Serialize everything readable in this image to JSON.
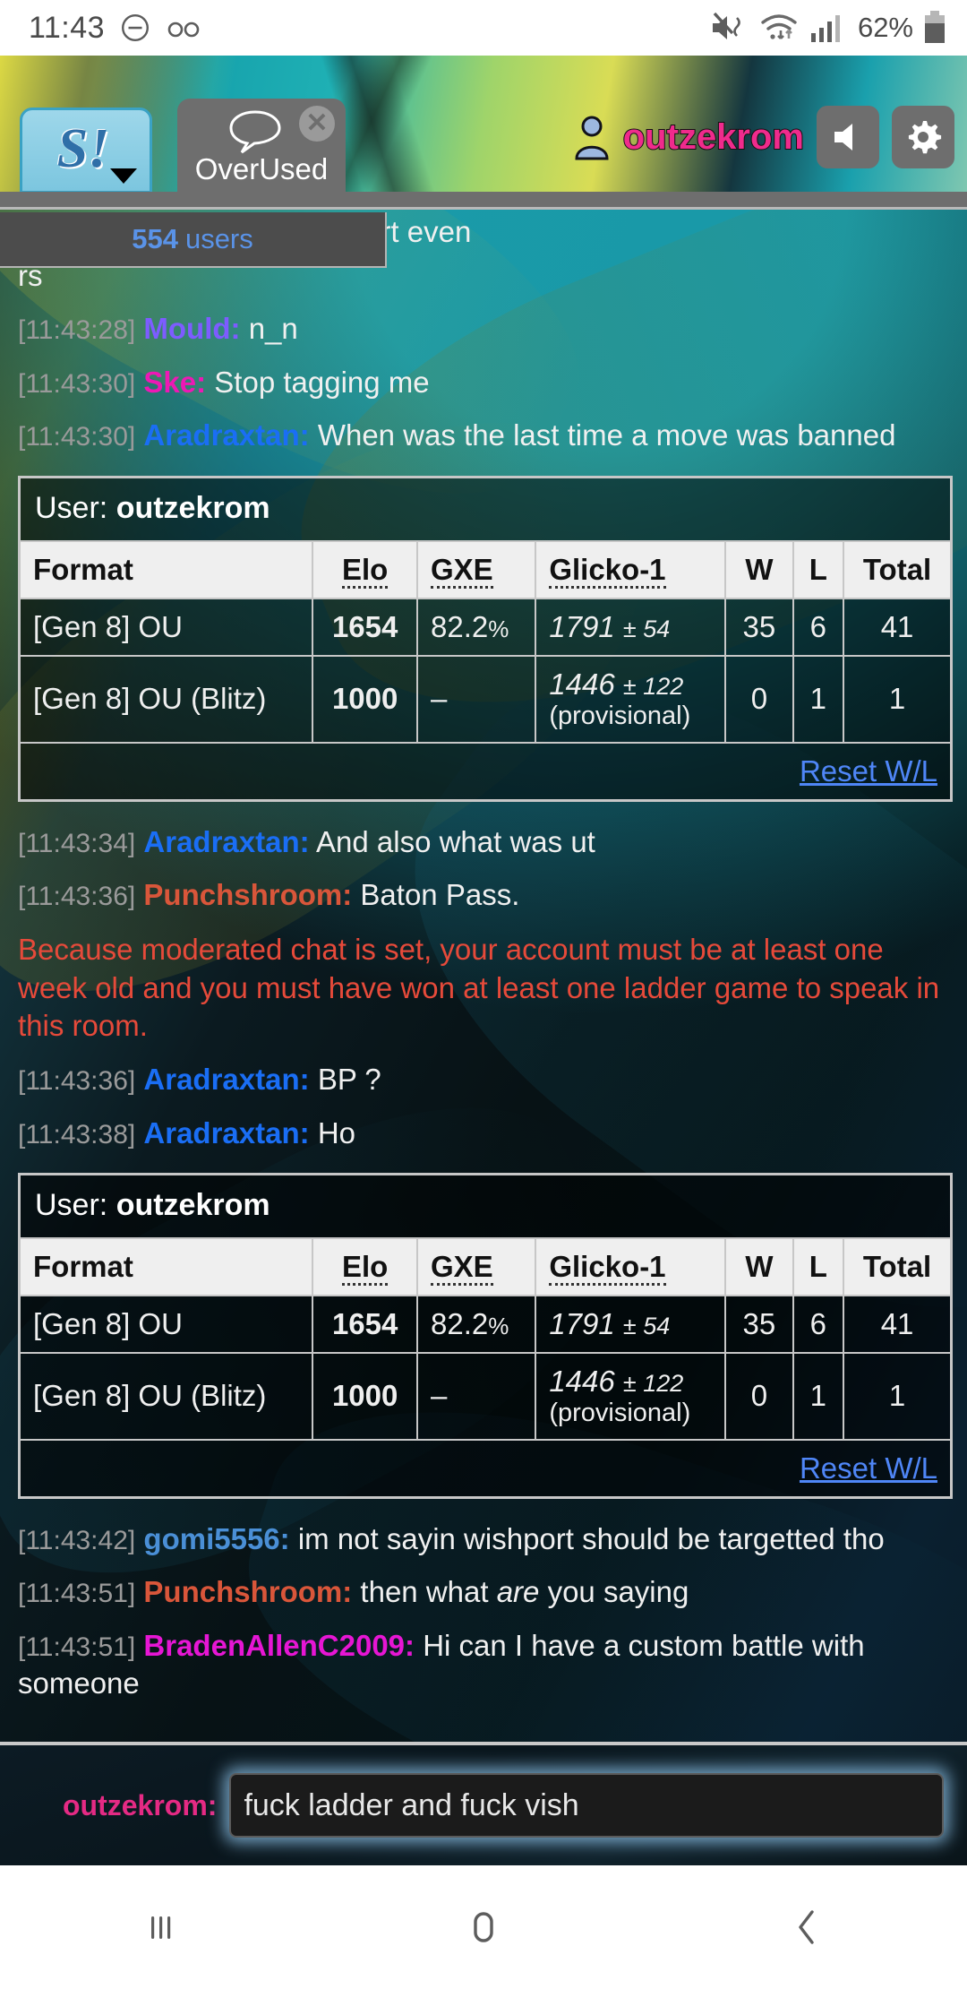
{
  "status_bar": {
    "clock": "11:43",
    "battery_text": "62%",
    "icons": [
      "dnd-icon",
      "voicemail-icon",
      "mute-vibrate-icon",
      "wifi-icon",
      "signal-icon",
      "battery-icon"
    ]
  },
  "app_header": {
    "logo_label": "S!",
    "room_tab": {
      "label": "OverUsed",
      "icon": "chat-bubble-icon",
      "close_icon": "close-icon"
    },
    "username": "outzekrom",
    "user_icon": "person-icon",
    "sound_button_icon": "volume-icon",
    "settings_button_icon": "gear-icon"
  },
  "users_bar": {
    "count": "554",
    "label": "users"
  },
  "messages": [
    {
      "type": "clipped",
      "text": "and u wanna target WishPort even"
    },
    {
      "type": "clipped2",
      "text": "rs"
    },
    {
      "type": "chat",
      "time": "[11:43:28]",
      "user": "Mould:",
      "color": "#7d5cff",
      "text": "n_n"
    },
    {
      "type": "chat",
      "time": "[11:43:30]",
      "user": "Ske:",
      "color": "#ed18b5",
      "text": "Stop tagging me"
    },
    {
      "type": "chat",
      "time": "[11:43:30]",
      "user": "Aradraxtan:",
      "color": "#1a6ef5",
      "text": "When was the last time a move was banned"
    },
    {
      "type": "table",
      "index": 0
    },
    {
      "type": "chat",
      "time": "[11:43:34]",
      "user": "Aradraxtan:",
      "color": "#1a6ef5",
      "text": "And also what was ut"
    },
    {
      "type": "chat",
      "time": "[11:43:36]",
      "user": "Punchshroom:",
      "color": "#d9563a",
      "text": "Baton Pass."
    },
    {
      "type": "notice",
      "text": "Because moderated chat is set, your account must be at least one week old and you must have won at least one ladder game to speak in this room."
    },
    {
      "type": "chat",
      "time": "[11:43:36]",
      "user": "Aradraxtan:",
      "color": "#1a6ef5",
      "text": "BP ?"
    },
    {
      "type": "chat",
      "time": "[11:43:38]",
      "user": "Aradraxtan:",
      "color": "#1a6ef5",
      "text": "Ho"
    },
    {
      "type": "table",
      "index": 1
    },
    {
      "type": "chat",
      "time": "[11:43:42]",
      "user": "gomi5556:",
      "color": "#4a8fd6",
      "text": "im not sayin wishport should be targetted tho"
    },
    {
      "type": "chat_em",
      "time": "[11:43:51]",
      "user": "Punchshroom:",
      "color": "#d9563a",
      "pre": "then what ",
      "em": "are",
      "post": " you saying"
    },
    {
      "type": "chat",
      "time": "[11:43:51]",
      "user": "BradenAllenC2009:",
      "color": "#e616d4",
      "text": "Hi can I have a custom battle with someone"
    }
  ],
  "rating_table": {
    "user_label": "User:",
    "user_name": "outzekrom",
    "columns": [
      "Format",
      "Elo",
      "GXE",
      "Glicko-1",
      "W",
      "L",
      "Total"
    ],
    "rows": [
      {
        "format": "[Gen 8] OU",
        "elo": "1654",
        "gxe_value": "82.2",
        "gxe_unit": "%",
        "glicko": "1791",
        "glicko_dev": "± 54",
        "provisional": "",
        "w": "35",
        "l": "6",
        "total": "41"
      },
      {
        "format": "[Gen 8] OU (Blitz)",
        "elo": "1000",
        "gxe_value": "–",
        "gxe_unit": "",
        "glicko": "1446",
        "glicko_dev": "± 122",
        "provisional": "(provisional)",
        "w": "0",
        "l": "1",
        "total": "1"
      }
    ],
    "reset_label": "Reset W/L"
  },
  "input_bar": {
    "user_prefix": "outzekrom:",
    "value": "fuck ladder and fuck vish",
    "placeholder": ""
  },
  "nav_bar": {
    "recents_icon": "recents-icon",
    "home_icon": "home-icon",
    "back_icon": "back-icon"
  },
  "colors": {
    "accent_pink": "#ef2b8c",
    "notice_red": "#e64a3a",
    "link_blue": "#4f86f7",
    "users_blue": "#5a93e8"
  }
}
